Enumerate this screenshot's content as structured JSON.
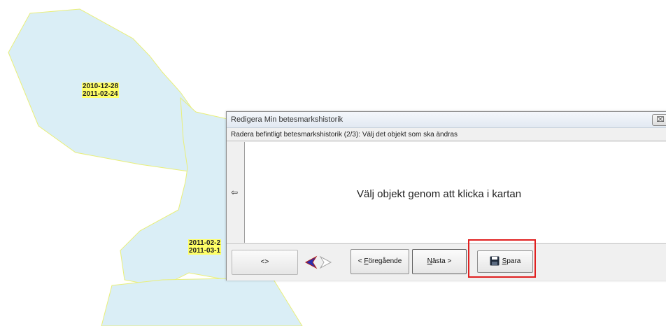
{
  "map": {
    "colors": {
      "polygon_fill": "#daeef6",
      "polygon_stroke": "#e9ef7a",
      "label_bg": "#ffff66"
    },
    "labels": {
      "a1": "2010-12-28",
      "a2": "2011-02-24",
      "b1": "2011-02-2",
      "b2": "2011-03-1"
    }
  },
  "dialog": {
    "title": "Redigera Min betesmarkshistorik",
    "close_symbol": "⌧",
    "instruction": "Radera befintligt betesmarkshistorik (2/3): Välj det objekt som ska ändras",
    "side_arrow": "⇦",
    "prompt": "Välj objekt genom att klicka i kartan",
    "toolbar": {
      "toggle_label": "<>",
      "back_icon": "back-arrow-icon",
      "forward_icon": "forward-arrow-icon",
      "prev_prefix": "< ",
      "prev_underlined": "F",
      "prev_rest": "öregående",
      "next_underlined": "N",
      "next_rest": "ästa >",
      "save_underlined": "S",
      "save_rest": "para",
      "save_icon": "floppy-disk-icon"
    },
    "highlight_color": "#e02020"
  }
}
